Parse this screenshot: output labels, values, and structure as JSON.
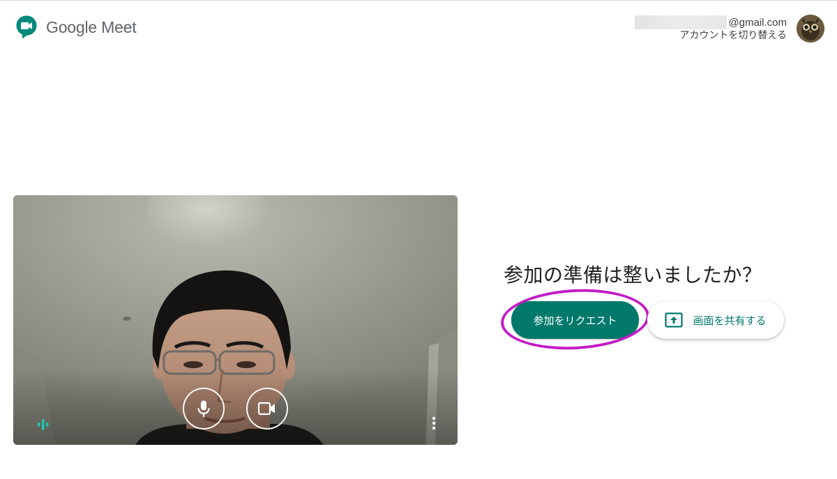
{
  "header": {
    "logo_text": "Google Meet",
    "account_email": "@gmail.com",
    "switch_account_label": "アカウントを切り替える"
  },
  "preview": {
    "mic_icon": "mic-icon",
    "camera_icon": "video-camera-icon",
    "audio_level_icon": "audio-level-icon",
    "more_icon": "more-vert-icon"
  },
  "join": {
    "title": "参加の準備は整いましたか？",
    "request_button_label": "参加をリクエスト",
    "present_button_label": "画面を共有する"
  },
  "colors": {
    "accent": "#00796b",
    "highlight": "#c31cc7",
    "audio_level": "#1ec9b0"
  }
}
